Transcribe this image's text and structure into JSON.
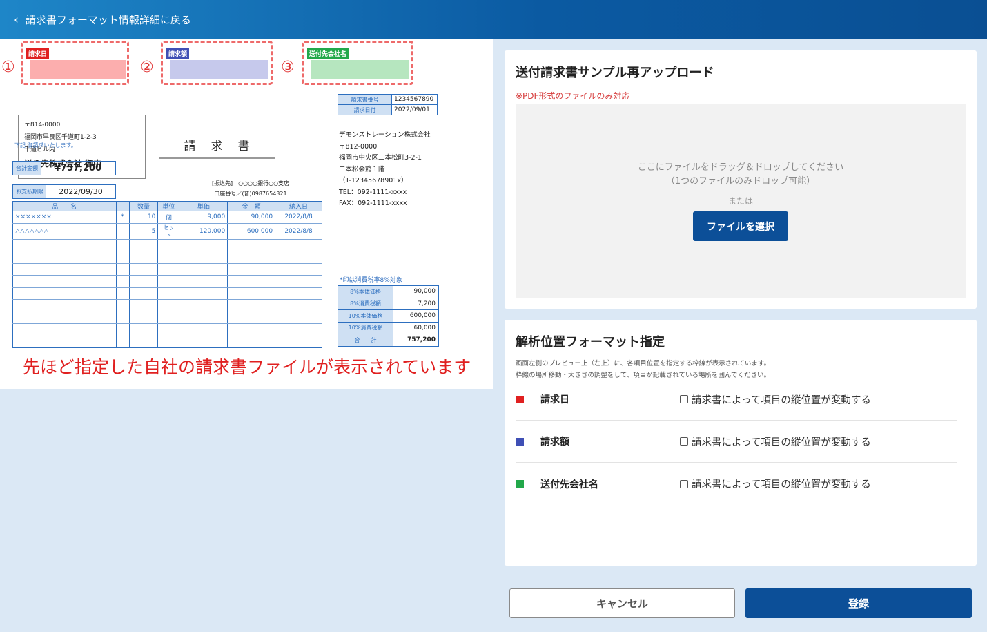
{
  "header": {
    "back_label": "請求書フォーマット情報詳細に戻る"
  },
  "preview": {
    "markers": [
      {
        "number": "①",
        "tag": "請求日",
        "color": "#e02020",
        "fill": "#fcaeae"
      },
      {
        "number": "②",
        "tag": "請求額",
        "color": "#3f4fb5",
        "fill": "#c6c9ec"
      },
      {
        "number": "③",
        "tag": "送付先会社名",
        "color": "#22a84a",
        "fill": "#b6e6bf"
      }
    ],
    "address": {
      "postal": "〒814-0000",
      "line1": "福岡市早良区千道町1-2-3",
      "line2": "千道ビル内",
      "recipient": "送り先株式会社 御中"
    },
    "doc_title": "請求書",
    "request_note": "下記 御請求いたします。",
    "total": {
      "label": "合計金額",
      "value": "¥757,200"
    },
    "due": {
      "label": "お支払期限",
      "value": "2022/09/30"
    },
    "bank": {
      "line1": "[振込先]　○○○○銀行○○支店",
      "line2": "口座番号／(普)0987654321"
    },
    "items_table": {
      "headers": [
        "品　　名",
        "",
        "数量",
        "単位",
        "単価",
        "金　額",
        "納入日"
      ],
      "rows": [
        [
          "×××××××",
          "*",
          "10",
          "個",
          "9,000",
          "90,000",
          "2022/8/8"
        ],
        [
          "△△△△△△△",
          "",
          "5",
          "セット",
          "120,000",
          "600,000",
          "2022/8/8"
        ]
      ]
    },
    "meta": {
      "invoice_no_label": "請求書番号",
      "invoice_no": "1234567890",
      "invoice_date_label": "請求日付",
      "invoice_date": "2022/09/01"
    },
    "company": {
      "name": "デモンストレーション株式会社",
      "postal": "〒812-0000",
      "addr1": "福岡市中央区二本松町3-2-1",
      "addr2": "二本松会館１階",
      "reg": "（T-12345678901x）",
      "tel": "TEL：092-1111-xxxx",
      "fax": "FAX：092-1111-xxxx"
    },
    "tax_note": "*印は消費税率8%対象",
    "tax_table": [
      {
        "label": "8%本体価格",
        "value": "90,000"
      },
      {
        "label": "8%消費税額",
        "value": "7,200"
      },
      {
        "label": "10%本体価格",
        "value": "600,000"
      },
      {
        "label": "10%消費税額",
        "value": "60,000"
      },
      {
        "label": "合　　計",
        "value": "757,200"
      }
    ],
    "caption": "先ほど指定した自社の請求書ファイルが表示されています"
  },
  "upload": {
    "title": "送付請求書サンプル再アップロード",
    "note": "※PDF形式のファイルのみ対応",
    "drop_line1": "ここにファイルをドラッグ＆ドロップしてください",
    "drop_line2": "（1つのファイルのみドロップ可能）",
    "or": "または",
    "select_button": "ファイルを選択"
  },
  "format": {
    "title": "解析位置フォーマット指定",
    "desc1": "画面左側のプレビュー上（左上）に、各項目位置を指定する枠線が表示されています。",
    "desc2": "枠線の場所移動・大きさの調整をして、項目が記載されている場所を囲んでください。",
    "rows": [
      {
        "label": "請求日",
        "color": "#e02020",
        "checkbox_label": "請求書によって項目の縦位置が変動する"
      },
      {
        "label": "請求額",
        "color": "#3f4fb5",
        "checkbox_label": "請求書によって項目の縦位置が変動する"
      },
      {
        "label": "送付先会社名",
        "color": "#22a84a",
        "checkbox_label": "請求書によって項目の縦位置が変動する"
      }
    ]
  },
  "actions": {
    "cancel": "キャンセル",
    "register": "登録"
  }
}
